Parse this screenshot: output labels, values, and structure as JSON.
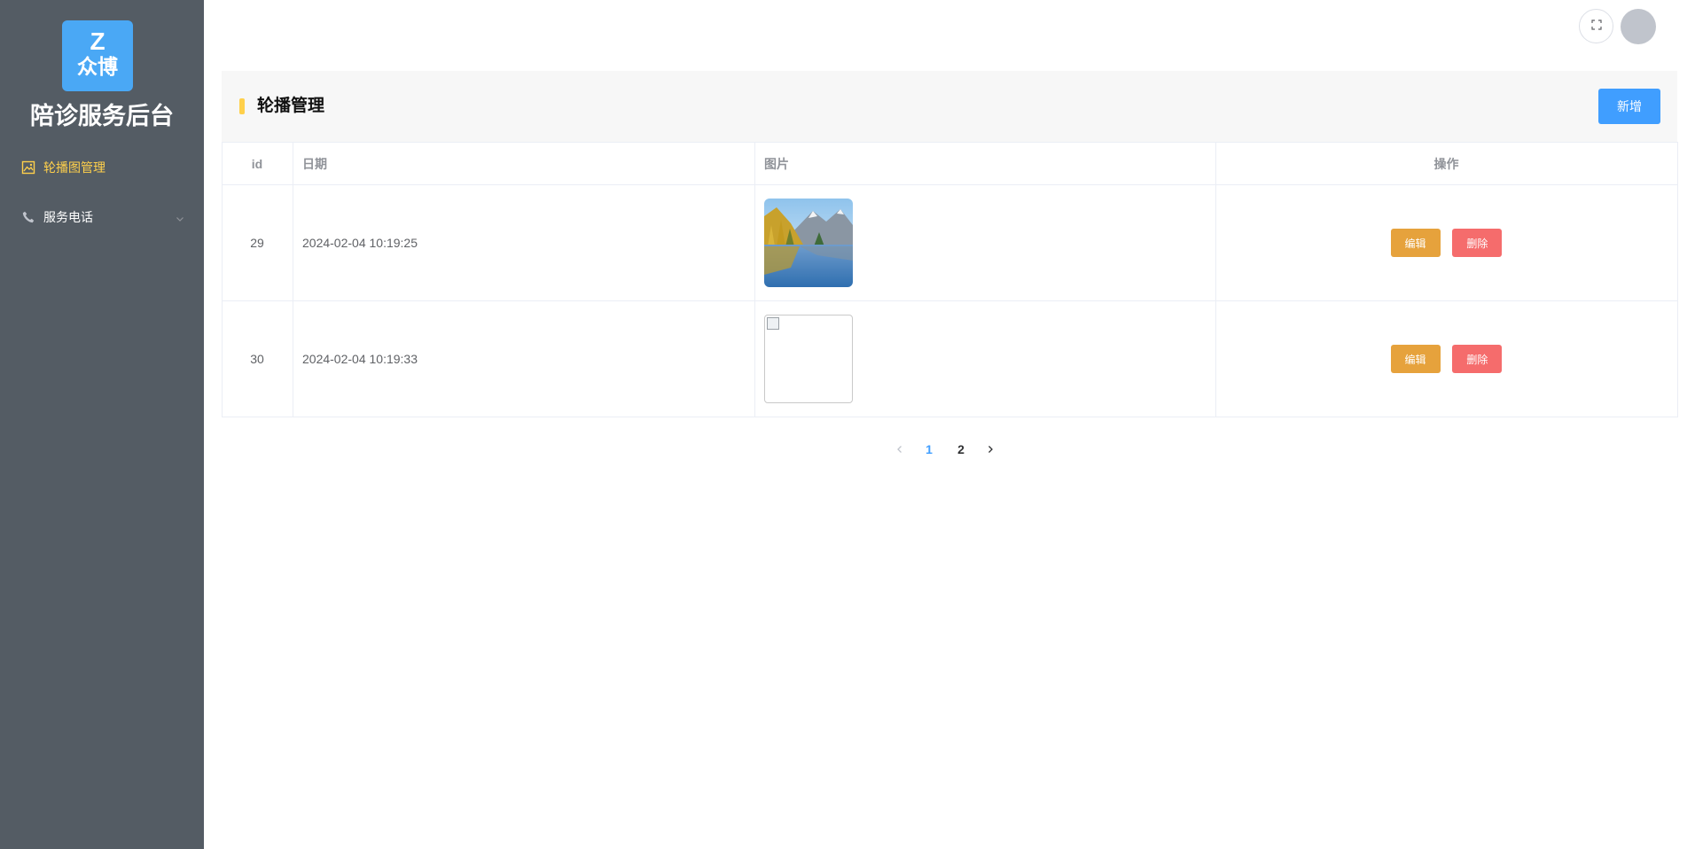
{
  "sidebar": {
    "logo": {
      "top_text": "Z",
      "bottom_text": "众博"
    },
    "app_title": "陪诊服务后台",
    "items": [
      {
        "label": "轮播图管理",
        "icon": "picture-icon",
        "active": true
      },
      {
        "label": "服务电话",
        "icon": "phone-icon",
        "active": false,
        "expandable": true
      }
    ]
  },
  "header": {
    "fullscreen_icon": "fullscreen-icon",
    "avatar": "user-avatar"
  },
  "panel": {
    "title": "轮播管理",
    "add_button_label": "新增"
  },
  "table": {
    "headers": {
      "id": "id",
      "date": "日期",
      "image": "图片",
      "actions": "操作"
    },
    "rows": [
      {
        "id": "29",
        "date": "2024-02-04 10:19:25",
        "image": "landscape-lake-autumn-trees",
        "edit_label": "编辑",
        "delete_label": "删除"
      },
      {
        "id": "30",
        "date": "2024-02-04 10:19:33",
        "image": "broken-image",
        "edit_label": "编辑",
        "delete_label": "删除"
      }
    ]
  },
  "pagination": {
    "pages": [
      "1",
      "2"
    ],
    "current": "1",
    "prev_icon": "chevron-left-icon",
    "next_icon": "chevron-right-icon"
  },
  "colors": {
    "sidebar_bg": "#545c64",
    "active_menu": "#ffd04b",
    "primary": "#409eff",
    "warning": "#e6a23c",
    "danger": "#f56c6c"
  }
}
